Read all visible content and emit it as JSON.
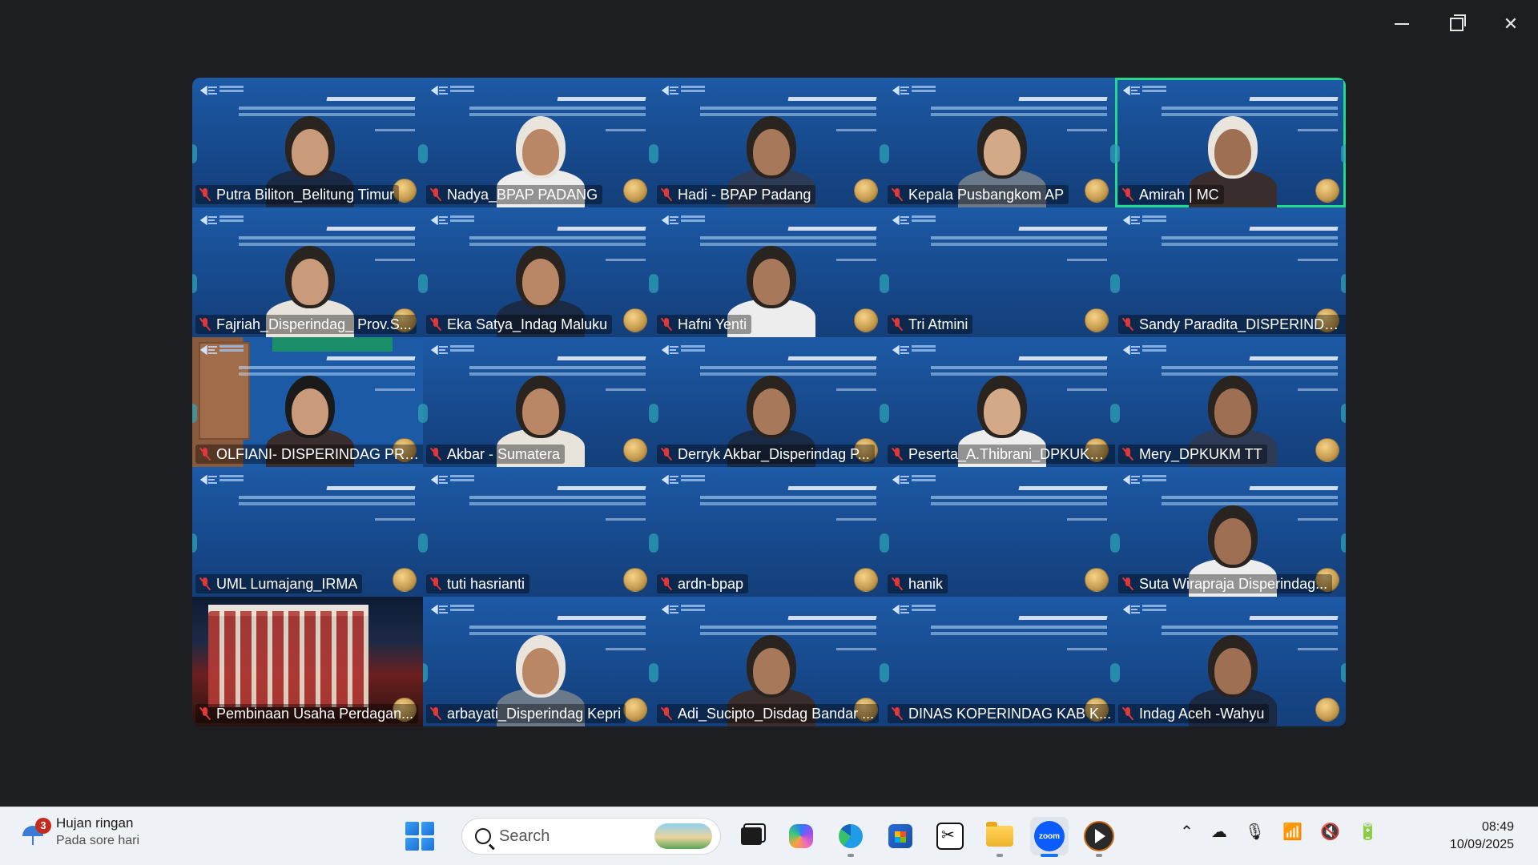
{
  "window": {
    "controls": {
      "minimize": "─",
      "close": "✕"
    }
  },
  "gallery": {
    "participants": [
      {
        "name": "Putra Biliton_Belitung Timur",
        "video": true
      },
      {
        "name": "Nadya_BPAP PADANG",
        "video": true
      },
      {
        "name": "Hadi - BPAP Padang",
        "video": true
      },
      {
        "name": "Kepala Pusbangkom AP",
        "video": true
      },
      {
        "name": "Amirah | MC",
        "video": true,
        "active_speaker": true
      },
      {
        "name": "Fajriah_Disperindag_ Prov.S...",
        "video": true
      },
      {
        "name": "Eka Satya_Indag Maluku",
        "video": true
      },
      {
        "name": "Hafni Yenti",
        "video": true
      },
      {
        "name": "Tri Atmini",
        "video": false
      },
      {
        "name": "Sandy Paradita_DISPERINDA...",
        "video": false
      },
      {
        "name": "OLFIANI- DISPERINDAG PRO...",
        "video": true
      },
      {
        "name": "Akbar - Sumatera",
        "video": true
      },
      {
        "name": "Derryk Akbar_Disperindag P...",
        "video": true
      },
      {
        "name": "Peserta_A.Thibrani_DPKUKM...",
        "video": true
      },
      {
        "name": "Mery_DPKUKM TT",
        "video": true
      },
      {
        "name": "UML Lumajang_IRMA",
        "video": false
      },
      {
        "name": "tuti hasrianti",
        "video": false
      },
      {
        "name": "ardn-bpap",
        "video": false
      },
      {
        "name": "hanik",
        "video": false
      },
      {
        "name": "Suta Wirapraja Disperindag...",
        "video": true
      },
      {
        "name": "Pembinaan Usaha Perdagan...",
        "video": false
      },
      {
        "name": "arbayati_Disperindag Kepri",
        "video": true
      },
      {
        "name": "Adi_Sucipto_Disdag Bandar ...",
        "video": true
      },
      {
        "name": "DINAS KOPERINDAG KAB K...",
        "video": false
      },
      {
        "name": "Indag Aceh -Wahyu",
        "video": true
      }
    ],
    "colors": {
      "active_border": "#23d98a",
      "mic_off": "#e0373a",
      "slide_bg": "#1d5aa6"
    }
  },
  "taskbar": {
    "weather": {
      "notification_count": "3",
      "condition": "Hujan ringan",
      "subtitle": "Pada sore hari"
    },
    "search": {
      "label": "Search"
    },
    "apps": [
      "task-view",
      "copilot",
      "edge",
      "microsoft-store",
      "capcut",
      "file-explorer",
      "zoom",
      "media-player"
    ],
    "zoom_label": "zoom",
    "tray": {
      "chevron": "^"
    },
    "clock": {
      "time": "08:49",
      "date": "10/09/2025"
    }
  }
}
